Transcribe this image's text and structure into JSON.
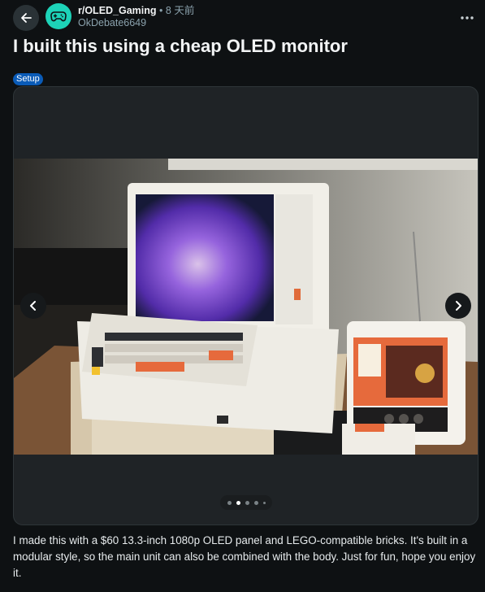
{
  "header": {
    "back_icon": "arrow-left-icon",
    "subreddit": "r/OLED_Gaming",
    "separator": "•",
    "time_ago": "8 天前",
    "author": "OkDebate6649",
    "more_icon": "more-horizontal-icon",
    "avatar_icon": "gamepad-icon",
    "avatar_color": "#1dd3b8"
  },
  "post": {
    "title": "I built this using a cheap OLED monitor",
    "flair": "Setup",
    "flair_color": "#0a5bb7",
    "body": "I made this with a $60 13.3-inch 1080p OLED panel and LEGO-compatible bricks. It's built in a modular style, so the main unit can also be combined with the body. Just for fun, hope you enjoy it."
  },
  "gallery": {
    "prev_icon": "chevron-left-icon",
    "next_icon": "chevron-right-icon",
    "total_pages": 5,
    "active_page": 2
  }
}
